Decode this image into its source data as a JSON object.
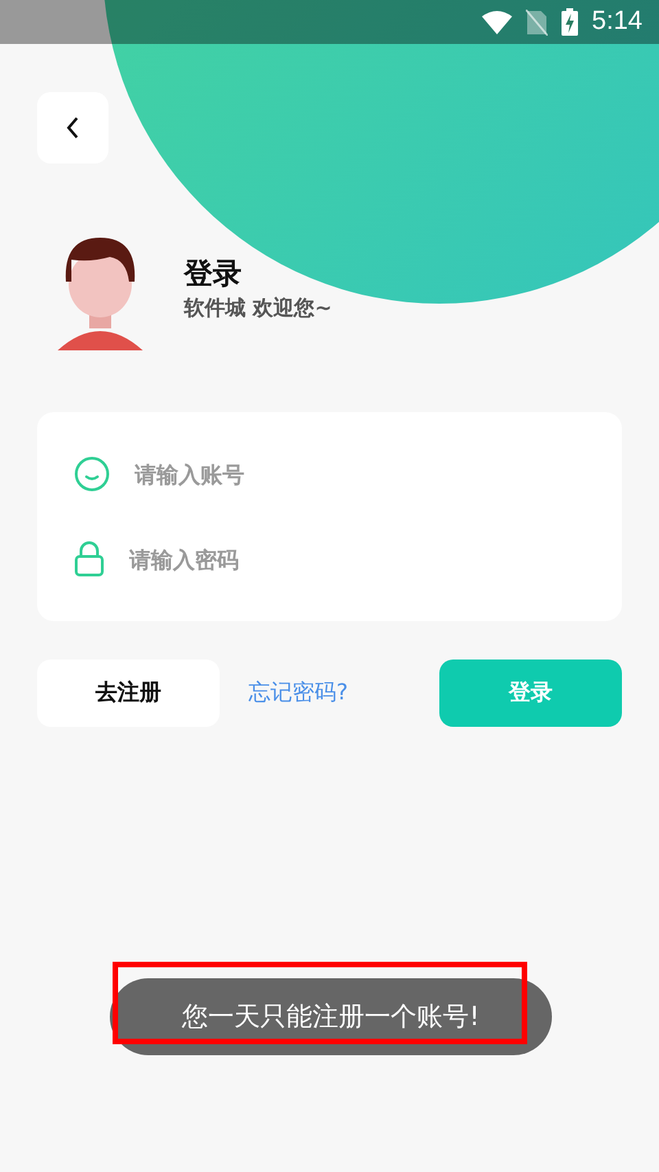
{
  "status_bar": {
    "time": "5:14"
  },
  "header": {
    "title": "登录",
    "subtitle": "软件城 欢迎您~"
  },
  "form": {
    "fields": [
      {
        "kind": "account",
        "placeholder": "请输入账号"
      },
      {
        "kind": "password",
        "placeholder": "请输入密码"
      }
    ]
  },
  "actions": {
    "register": "去注册",
    "forgot": "忘记密码?",
    "login": "登录"
  },
  "toast": {
    "message": "您一天只能注册一个账号!"
  }
}
